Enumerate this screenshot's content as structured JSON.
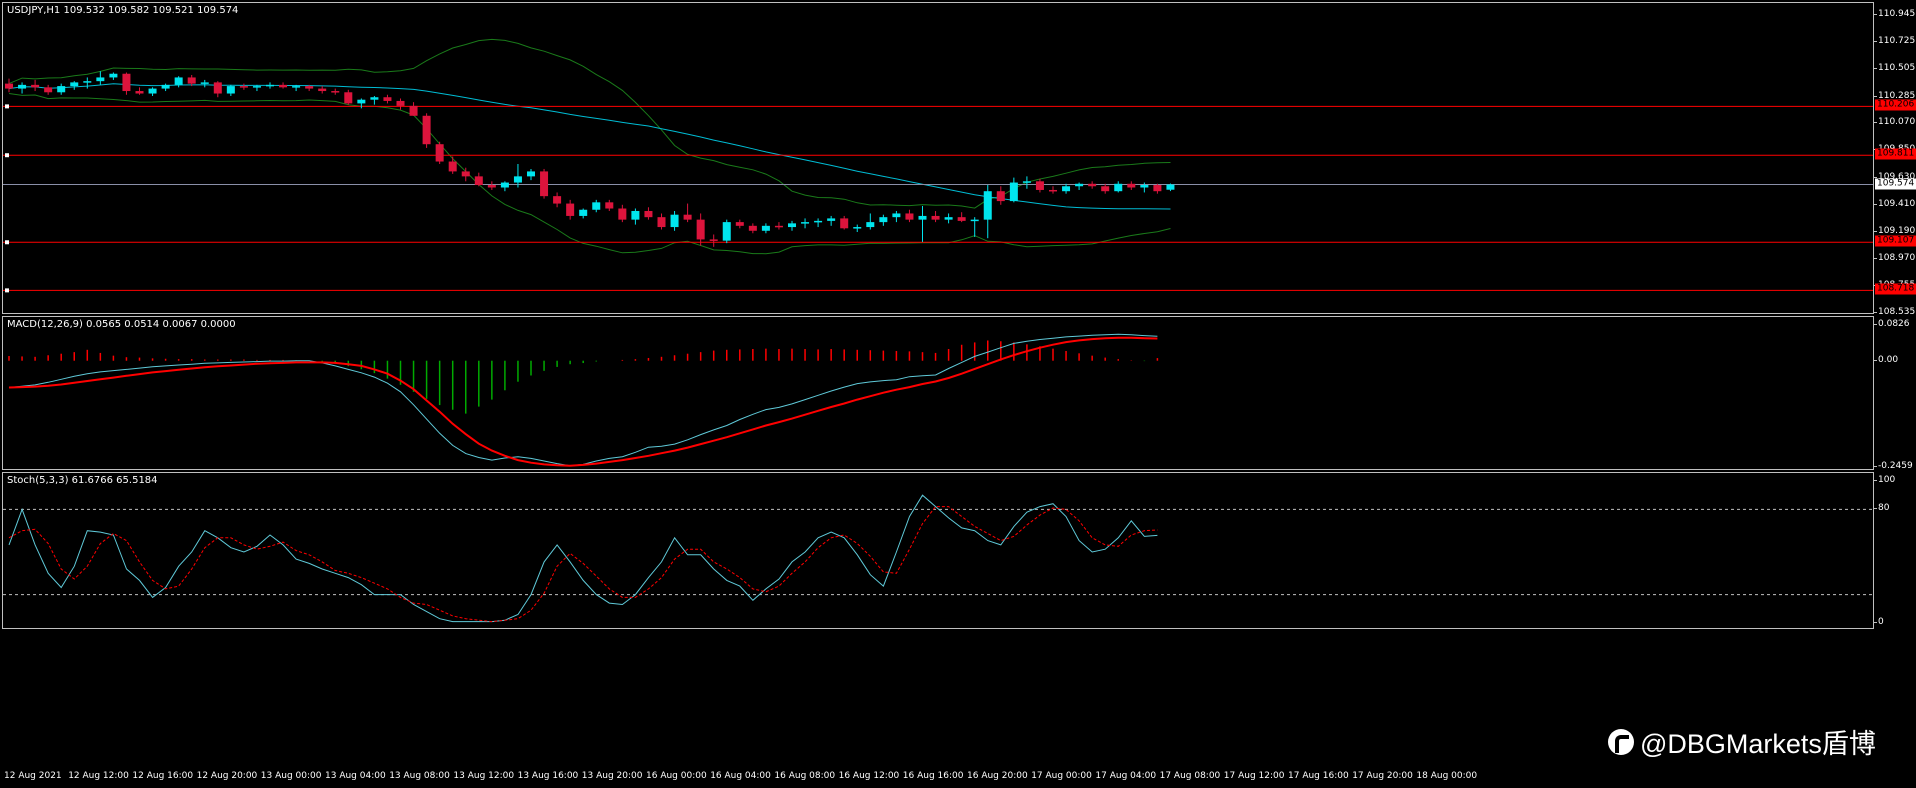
{
  "chart_data": [
    {
      "type": "candlestick",
      "title": "USDJPY,H1  109.532 109.582 109.521 109.574",
      "ylim": [
        108.535,
        110.945
      ],
      "y_ticks": [
        "110.945",
        "110.725",
        "110.505",
        "110.285",
        "110.070",
        "109.850",
        "109.630",
        "109.410",
        "109.190",
        "108.970",
        "108.755",
        "108.535"
      ],
      "current_price": "109.574",
      "horizontal_levels": [
        {
          "value": 110.206,
          "label": "110.206"
        },
        {
          "value": 109.811,
          "label": "109.811"
        },
        {
          "value": 109.107,
          "label": "109.107"
        },
        {
          "value": 108.718,
          "label": "108.718"
        }
      ],
      "x_labels": [
        "12 Aug 2021",
        "12 Aug 12:00",
        "12 Aug 16:00",
        "12 Aug 20:00",
        "13 Aug 00:00",
        "13 Aug 04:00",
        "13 Aug 08:00",
        "13 Aug 12:00",
        "13 Aug 16:00",
        "13 Aug 20:00",
        "16 Aug 00:00",
        "16 Aug 04:00",
        "16 Aug 08:00",
        "16 Aug 12:00",
        "16 Aug 16:00",
        "16 Aug 20:00",
        "17 Aug 00:00",
        "17 Aug 04:00",
        "17 Aug 08:00",
        "17 Aug 12:00",
        "17 Aug 16:00",
        "17 Aug 20:00",
        "18 Aug 00:00"
      ],
      "candles_ohlc": [
        [
          110.39,
          110.43,
          110.32,
          110.35
        ],
        [
          110.35,
          110.4,
          110.31,
          110.38
        ],
        [
          110.38,
          110.42,
          110.33,
          110.36
        ],
        [
          110.36,
          110.38,
          110.3,
          110.32
        ],
        [
          110.32,
          110.39,
          110.3,
          110.37
        ],
        [
          110.37,
          110.41,
          110.34,
          110.4
        ],
        [
          110.4,
          110.44,
          110.35,
          110.41
        ],
        [
          110.41,
          110.49,
          110.38,
          110.44
        ],
        [
          110.44,
          110.48,
          110.42,
          110.47
        ],
        [
          110.47,
          110.48,
          110.3,
          110.33
        ],
        [
          110.33,
          110.36,
          110.3,
          110.31
        ],
        [
          110.31,
          110.36,
          110.29,
          110.35
        ],
        [
          110.35,
          110.39,
          110.33,
          110.38
        ],
        [
          110.38,
          110.45,
          110.36,
          110.44
        ],
        [
          110.44,
          110.46,
          110.37,
          110.39
        ],
        [
          110.39,
          110.42,
          110.36,
          110.4
        ],
        [
          110.4,
          110.41,
          110.28,
          110.31
        ],
        [
          110.31,
          110.38,
          110.29,
          110.37
        ],
        [
          110.37,
          110.39,
          110.34,
          110.36
        ],
        [
          110.36,
          110.38,
          110.33,
          110.37
        ],
        [
          110.37,
          110.4,
          110.35,
          110.38
        ],
        [
          110.38,
          110.4,
          110.35,
          110.36
        ],
        [
          110.36,
          110.38,
          110.33,
          110.37
        ],
        [
          110.37,
          110.38,
          110.33,
          110.35
        ],
        [
          110.35,
          110.37,
          110.31,
          110.33
        ],
        [
          110.33,
          110.35,
          110.3,
          110.32
        ],
        [
          110.32,
          110.34,
          110.22,
          110.23
        ],
        [
          110.23,
          110.27,
          110.19,
          110.26
        ],
        [
          110.26,
          110.29,
          110.22,
          110.28
        ],
        [
          110.28,
          110.3,
          110.23,
          110.25
        ],
        [
          110.25,
          110.27,
          110.18,
          110.21
        ],
        [
          110.21,
          110.24,
          110.13,
          110.13
        ],
        [
          110.13,
          110.15,
          109.87,
          109.9
        ],
        [
          109.9,
          109.92,
          109.74,
          109.76
        ],
        [
          109.76,
          109.8,
          109.66,
          109.68
        ],
        [
          109.68,
          109.71,
          109.6,
          109.64
        ],
        [
          109.64,
          109.67,
          109.56,
          109.57
        ],
        [
          109.57,
          109.6,
          109.53,
          109.55
        ],
        [
          109.55,
          109.6,
          109.52,
          109.59
        ],
        [
          109.59,
          109.74,
          109.55,
          109.64
        ],
        [
          109.64,
          109.7,
          109.61,
          109.68
        ],
        [
          109.68,
          109.7,
          109.46,
          109.48
        ],
        [
          109.48,
          109.51,
          109.39,
          109.42
        ],
        [
          109.42,
          109.45,
          109.29,
          109.32
        ],
        [
          109.32,
          109.38,
          109.3,
          109.37
        ],
        [
          109.37,
          109.45,
          109.35,
          109.43
        ],
        [
          109.43,
          109.45,
          109.36,
          109.38
        ],
        [
          109.38,
          109.41,
          109.27,
          109.29
        ],
        [
          109.29,
          109.38,
          109.25,
          109.36
        ],
        [
          109.36,
          109.39,
          109.29,
          109.31
        ],
        [
          109.31,
          109.34,
          109.21,
          109.23
        ],
        [
          109.23,
          109.36,
          109.2,
          109.33
        ],
        [
          109.33,
          109.42,
          109.27,
          109.29
        ],
        [
          109.29,
          109.34,
          109.08,
          109.13
        ],
        [
          109.13,
          109.17,
          109.07,
          109.12
        ],
        [
          109.12,
          109.29,
          109.1,
          109.27
        ],
        [
          109.27,
          109.29,
          109.22,
          109.24
        ],
        [
          109.24,
          109.26,
          109.18,
          109.2
        ],
        [
          109.2,
          109.26,
          109.18,
          109.24
        ],
        [
          109.24,
          109.27,
          109.21,
          109.23
        ],
        [
          109.23,
          109.28,
          109.2,
          109.26
        ],
        [
          109.26,
          109.3,
          109.22,
          109.27
        ],
        [
          109.27,
          109.3,
          109.23,
          109.28
        ],
        [
          109.28,
          109.32,
          109.24,
          109.3
        ],
        [
          109.3,
          109.32,
          109.21,
          109.22
        ],
        [
          109.22,
          109.25,
          109.19,
          109.23
        ],
        [
          109.23,
          109.34,
          109.21,
          109.27
        ],
        [
          109.27,
          109.33,
          109.24,
          109.31
        ],
        [
          109.31,
          109.36,
          109.27,
          109.34
        ],
        [
          109.34,
          109.37,
          109.27,
          109.29
        ],
        [
          109.29,
          109.4,
          109.11,
          109.32
        ],
        [
          109.32,
          109.36,
          109.27,
          109.29
        ],
        [
          109.29,
          109.34,
          109.26,
          109.31
        ],
        [
          109.31,
          109.35,
          109.27,
          109.28
        ],
        [
          109.28,
          109.31,
          109.15,
          109.29
        ],
        [
          109.29,
          109.57,
          109.14,
          109.52
        ],
        [
          109.52,
          109.56,
          109.41,
          109.44
        ],
        [
          109.44,
          109.63,
          109.43,
          109.59
        ],
        [
          109.59,
          109.64,
          109.54,
          109.6
        ],
        [
          109.6,
          109.62,
          109.51,
          109.53
        ],
        [
          109.53,
          109.56,
          109.5,
          109.52
        ],
        [
          109.52,
          109.58,
          109.5,
          109.56
        ],
        [
          109.56,
          109.59,
          109.53,
          109.58
        ],
        [
          109.58,
          109.6,
          109.54,
          109.56
        ],
        [
          109.56,
          109.58,
          109.5,
          109.52
        ],
        [
          109.52,
          109.6,
          109.51,
          109.58
        ],
        [
          109.58,
          109.6,
          109.53,
          109.55
        ],
        [
          109.55,
          109.59,
          109.51,
          109.57
        ],
        [
          109.57,
          109.58,
          109.5,
          109.52
        ],
        [
          109.532,
          109.582,
          109.521,
          109.574
        ]
      ]
    },
    {
      "type": "line",
      "title": "MACD(12,26,9) 0.0565 0.0514 0.0067 0.0000",
      "ylim": [
        -0.2459,
        0.0826
      ],
      "y_ticks": [
        "0.0826",
        "0.00",
        "-0.2459"
      ],
      "series": [
        {
          "values": [
            0.012,
            0.011,
            0.01,
            0.014,
            0.018,
            0.022,
            0.028,
            0.02,
            0.013,
            0.009,
            0.008,
            0.006,
            0.005,
            0.004,
            0.004,
            0.003,
            0.003,
            0.003,
            0.003,
            0.002,
            0.002,
            0.002,
            0.001,
            0.0,
            -0.004,
            -0.008,
            -0.014,
            -0.022,
            -0.032,
            -0.046,
            -0.062,
            -0.08,
            -0.098,
            -0.114,
            -0.126,
            -0.136,
            -0.118,
            -0.1,
            -0.076,
            -0.054,
            -0.038,
            -0.026,
            -0.016,
            -0.009,
            -0.006,
            -0.002,
            0.0,
            0.002,
            0.004,
            0.007,
            0.01,
            0.014,
            0.018,
            0.022,
            0.026,
            0.028,
            0.029,
            0.03,
            0.031,
            0.03,
            0.031,
            0.03,
            0.029,
            0.03,
            0.029,
            0.028,
            0.027,
            0.026,
            0.025,
            0.024,
            0.022,
            0.02,
            0.03,
            0.041,
            0.047,
            0.052,
            0.05,
            0.047,
            0.042,
            0.037,
            0.031,
            0.025,
            0.019,
            0.013,
            0.008,
            0.004,
            0.001,
            -0.001,
            0.0067
          ]
        },
        {
          "values": [
            -0.062,
            -0.059,
            -0.056,
            -0.05,
            -0.043,
            -0.036,
            -0.03,
            -0.026,
            -0.023,
            -0.02,
            -0.017,
            -0.014,
            -0.012,
            -0.01,
            -0.008,
            -0.006,
            -0.005,
            -0.004,
            -0.003,
            -0.002,
            -0.001,
            -0.001,
            0.0,
            0.0,
            -0.005,
            -0.012,
            -0.02,
            -0.028,
            -0.038,
            -0.052,
            -0.072,
            -0.102,
            -0.135,
            -0.168,
            -0.196,
            -0.215,
            -0.224,
            -0.23,
            -0.225,
            -0.222,
            -0.226,
            -0.232,
            -0.238,
            -0.243,
            -0.24,
            -0.232,
            -0.226,
            -0.222,
            -0.212,
            -0.2,
            -0.198,
            -0.193,
            -0.183,
            -0.171,
            -0.16,
            -0.15,
            -0.136,
            -0.124,
            -0.113,
            -0.108,
            -0.1,
            -0.09,
            -0.08,
            -0.07,
            -0.061,
            -0.053,
            -0.049,
            -0.046,
            -0.044,
            -0.037,
            -0.035,
            -0.033,
            -0.018,
            -0.004,
            0.01,
            0.02,
            0.03,
            0.04,
            0.045,
            0.049,
            0.052,
            0.055,
            0.057,
            0.059,
            0.06,
            0.061,
            0.06,
            0.058,
            0.0565
          ]
        },
        {
          "values": [
            -0.062,
            -0.061,
            -0.06,
            -0.058,
            -0.055,
            -0.051,
            -0.047,
            -0.043,
            -0.039,
            -0.035,
            -0.031,
            -0.027,
            -0.024,
            -0.021,
            -0.018,
            -0.015,
            -0.013,
            -0.011,
            -0.009,
            -0.007,
            -0.006,
            -0.005,
            -0.004,
            -0.004,
            -0.004,
            -0.005,
            -0.008,
            -0.012,
            -0.02,
            -0.03,
            -0.046,
            -0.066,
            -0.092,
            -0.118,
            -0.146,
            -0.17,
            -0.192,
            -0.208,
            -0.22,
            -0.23,
            -0.236,
            -0.24,
            -0.242,
            -0.243,
            -0.241,
            -0.238,
            -0.234,
            -0.23,
            -0.225,
            -0.22,
            -0.214,
            -0.208,
            -0.201,
            -0.193,
            -0.185,
            -0.177,
            -0.168,
            -0.159,
            -0.15,
            -0.142,
            -0.134,
            -0.125,
            -0.116,
            -0.107,
            -0.099,
            -0.09,
            -0.082,
            -0.074,
            -0.067,
            -0.061,
            -0.054,
            -0.048,
            -0.04,
            -0.03,
            -0.019,
            -0.008,
            0.003,
            0.013,
            0.022,
            0.03,
            0.037,
            0.043,
            0.047,
            0.05,
            0.052,
            0.053,
            0.053,
            0.052,
            0.0514
          ]
        }
      ]
    },
    {
      "type": "line",
      "title": "Stoch(5,3,3) 61.6766 65.5184",
      "ylim": [
        0,
        100
      ],
      "y_ticks": [
        "100",
        "80",
        "0"
      ],
      "levels": [
        80,
        20
      ],
      "series": [
        {
          "values": [
            55,
            80,
            55,
            35,
            25,
            40,
            65,
            64,
            62,
            38,
            30,
            18,
            25,
            40,
            50,
            65,
            60,
            53,
            50,
            54,
            62,
            55,
            45,
            42,
            38,
            35,
            32,
            27,
            20,
            20,
            20,
            13,
            8,
            3,
            1,
            1,
            1,
            1,
            2,
            6,
            20,
            43,
            55,
            43,
            30,
            20,
            14,
            13,
            20,
            32,
            43,
            60,
            48,
            48,
            38,
            30,
            26,
            16,
            24,
            31,
            43,
            50,
            60,
            64,
            60,
            48,
            34,
            26,
            50,
            75,
            90,
            82,
            74,
            67,
            65,
            58,
            55,
            68,
            78,
            82,
            84,
            75,
            58,
            50,
            52,
            60,
            72,
            61,
            61.6766
          ]
        },
        {
          "values": [
            60,
            65,
            66,
            56,
            38,
            31,
            40,
            56,
            63,
            58,
            43,
            30,
            24,
            26,
            38,
            53,
            60,
            60,
            55,
            52,
            54,
            57,
            51,
            48,
            43,
            37,
            35,
            32,
            28,
            24,
            18,
            14,
            13,
            9,
            5,
            3,
            2,
            1,
            2,
            3,
            9,
            21,
            40,
            49,
            42,
            33,
            24,
            18,
            18,
            24,
            32,
            45,
            52,
            52,
            43,
            38,
            32,
            24,
            22,
            26,
            35,
            43,
            53,
            60,
            62,
            56,
            47,
            36,
            35,
            52,
            70,
            82,
            82,
            75,
            68,
            63,
            58,
            61,
            69,
            76,
            81,
            80,
            72,
            60,
            55,
            54,
            62,
            65,
            65.5184
          ]
        }
      ]
    },
    {
      "watermark": "@DBGMarkets盾博"
    }
  ],
  "colors": {
    "bull": "#00e5ee",
    "bear": "#dc143c",
    "ma": "#00bcd4",
    "bands": "#1a7a1a",
    "level": "#ff0000",
    "macd_hist_pos": "#ff0000",
    "macd_hist_neg": "#00aa00",
    "signal": "#ff0000",
    "macd_line": "#5fc9d8",
    "stoch_main": "#5fc9d8",
    "stoch_signal": "#ff0000"
  }
}
